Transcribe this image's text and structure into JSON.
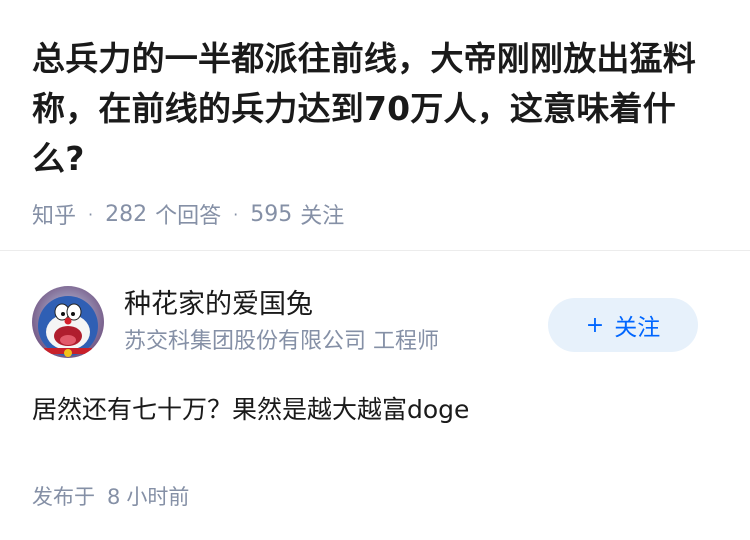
{
  "question": {
    "title": "总兵力的一半都派往前线，大帝刚刚放出猛料称，在前线的兵力达到70万人，这意味着什么?",
    "source": "知乎",
    "answer_count": "282",
    "answer_label": "个回答",
    "follower_count": "595",
    "follower_label": "关注"
  },
  "answer": {
    "author_name": "种花家的爱国兔",
    "author_bio": "苏交科集团股份有限公司 工程师",
    "follow_plus": "+",
    "follow_label": "关注",
    "content": "居然还有七十万？果然是越大越富doge",
    "posted_prefix": "发布于",
    "posted_time_num": "8",
    "posted_time_unit": "小时前"
  },
  "colors": {
    "title": "#1a1a1a",
    "meta": "#8590a6",
    "follow_bg": "#e7f1fb",
    "follow_text": "#0066ff"
  }
}
